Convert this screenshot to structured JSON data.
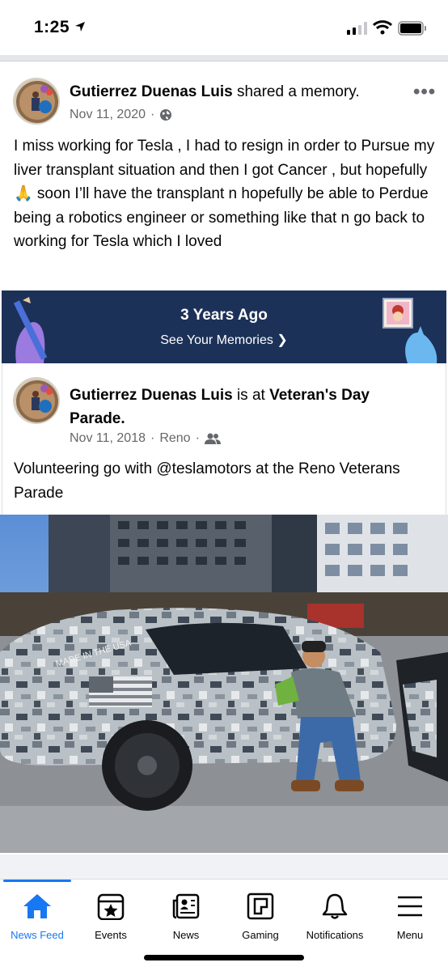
{
  "status_bar": {
    "time": "1:25"
  },
  "post": {
    "author": "Gutierrez Duenas Luis",
    "action": " shared a memory.",
    "date": "Nov 11, 2020",
    "privacy_icon": "globe-icon",
    "text": "I miss working for Tesla , I had to resign in order to Pursue my liver transplant situation and then I got Cancer , but hopefully 🙏 soon I’ll have the transplant n hopefully be able to Perdue being a robotics engineer or something like that n go back to working for Tesla which I loved"
  },
  "memories_banner": {
    "title": "3 Years Ago",
    "link": "See Your Memories ❯"
  },
  "shared_post": {
    "author": "Gutierrez Duenas Luis",
    "connector": " is at ",
    "place": "Veteran's Day Parade",
    "place_suffix": ".",
    "date": "Nov 11, 2018",
    "location": "Reno",
    "audience_icon": "friends-icon",
    "text": "Volunteering go with @teslamotors at the Reno Veterans Parade",
    "photo_text": "MADE IN THE USA"
  },
  "tabs": [
    {
      "label": "News Feed",
      "icon": "home-icon",
      "active": true
    },
    {
      "label": "Events",
      "icon": "calendar-star-icon",
      "active": false
    },
    {
      "label": "News",
      "icon": "newspaper-icon",
      "active": false
    },
    {
      "label": "Gaming",
      "icon": "gaming-icon",
      "active": false
    },
    {
      "label": "Notifications",
      "icon": "bell-icon",
      "active": false
    },
    {
      "label": "Menu",
      "icon": "hamburger-icon",
      "active": false
    }
  ],
  "colors": {
    "accent": "#1877f2",
    "banner": "#1c3158",
    "secondary_text": "#65676b"
  }
}
